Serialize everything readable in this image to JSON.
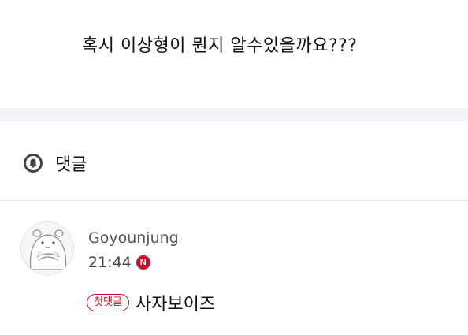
{
  "post": {
    "question": "혹시 이상형이 뭔지 알수있을까요???"
  },
  "comments": {
    "title": "댓글",
    "icon": "bell-icon",
    "items": [
      {
        "author": "Goyounjung",
        "time": "21:44",
        "new_badge": "N",
        "first_badge": "첫댓글",
        "text": "사자보이즈",
        "avatar_icon": "hamster-avatar"
      }
    ]
  },
  "colors": {
    "accent_red": "#c8102e",
    "separator": "#f3f4f7"
  }
}
